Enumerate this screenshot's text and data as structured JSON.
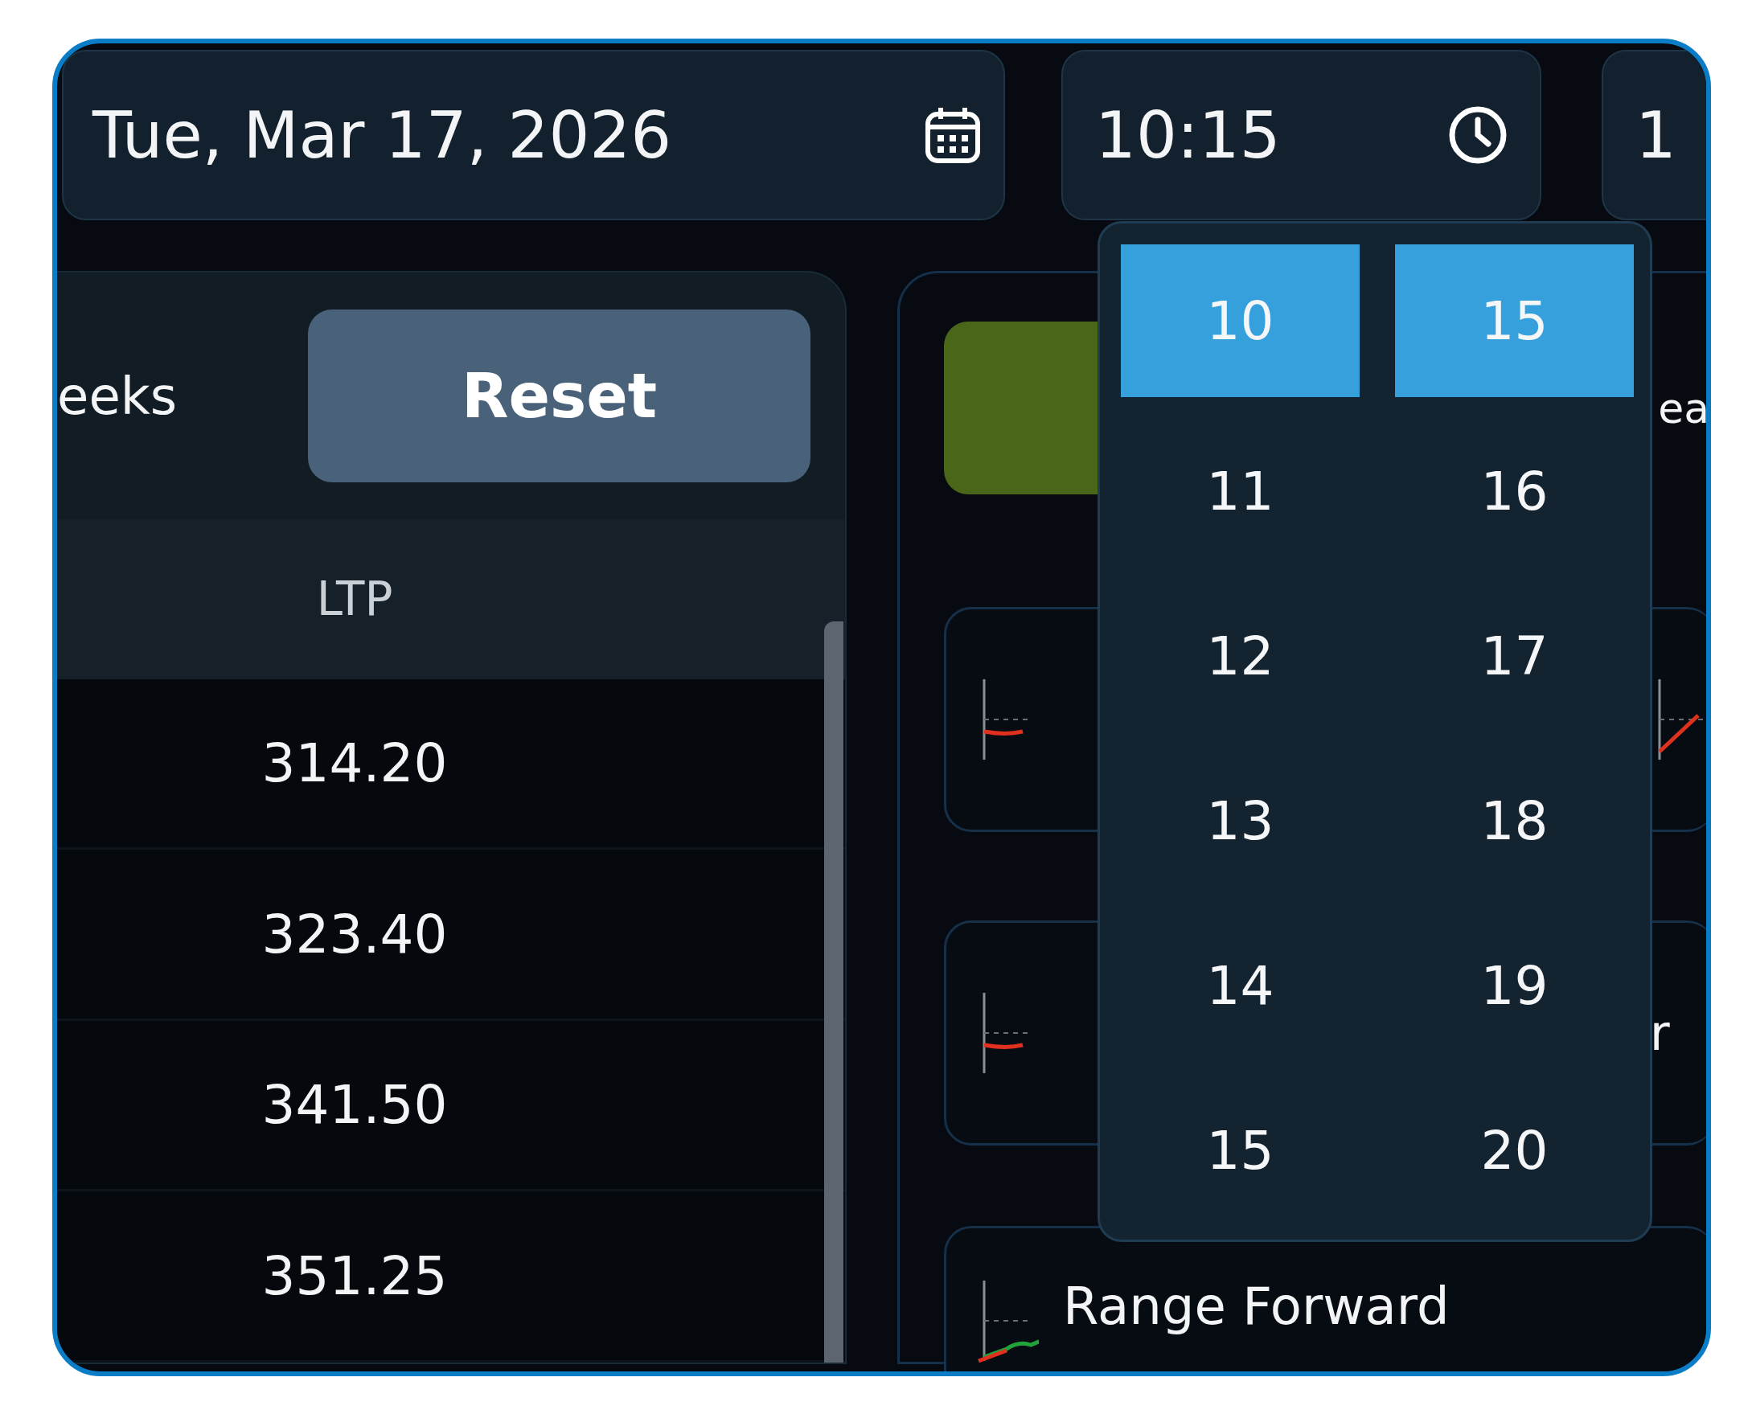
{
  "date_field": {
    "value": "Tue, Mar 17, 2026"
  },
  "time_field": {
    "value": "10:15"
  },
  "range_field": {
    "value": "1"
  },
  "left_panel": {
    "label": "eeks",
    "reset_button": "Reset",
    "table": {
      "columns": [
        "LTP"
      ],
      "rows": [
        [
          "314.20"
        ],
        [
          "323.40"
        ],
        [
          "341.50"
        ],
        [
          "351.25"
        ]
      ]
    }
  },
  "right_panel": {
    "header_text": "ea",
    "cards": [
      {
        "kind": "falling"
      },
      {
        "kind": "rising"
      },
      {
        "kind": "falling"
      },
      {
        "kind": "label",
        "text": "r"
      },
      {
        "kind": "wide",
        "text": "Range Forward"
      }
    ]
  },
  "time_picker": {
    "hours": [
      {
        "label": "10",
        "selected": true
      },
      {
        "label": "11",
        "selected": false
      },
      {
        "label": "12",
        "selected": false
      },
      {
        "label": "13",
        "selected": false
      },
      {
        "label": "14",
        "selected": false
      },
      {
        "label": "15",
        "selected": false
      }
    ],
    "minutes": [
      {
        "label": "15",
        "selected": true
      },
      {
        "label": "16",
        "selected": false
      },
      {
        "label": "17",
        "selected": false
      },
      {
        "label": "18",
        "selected": false
      },
      {
        "label": "19",
        "selected": false
      },
      {
        "label": "20",
        "selected": false
      }
    ]
  }
}
